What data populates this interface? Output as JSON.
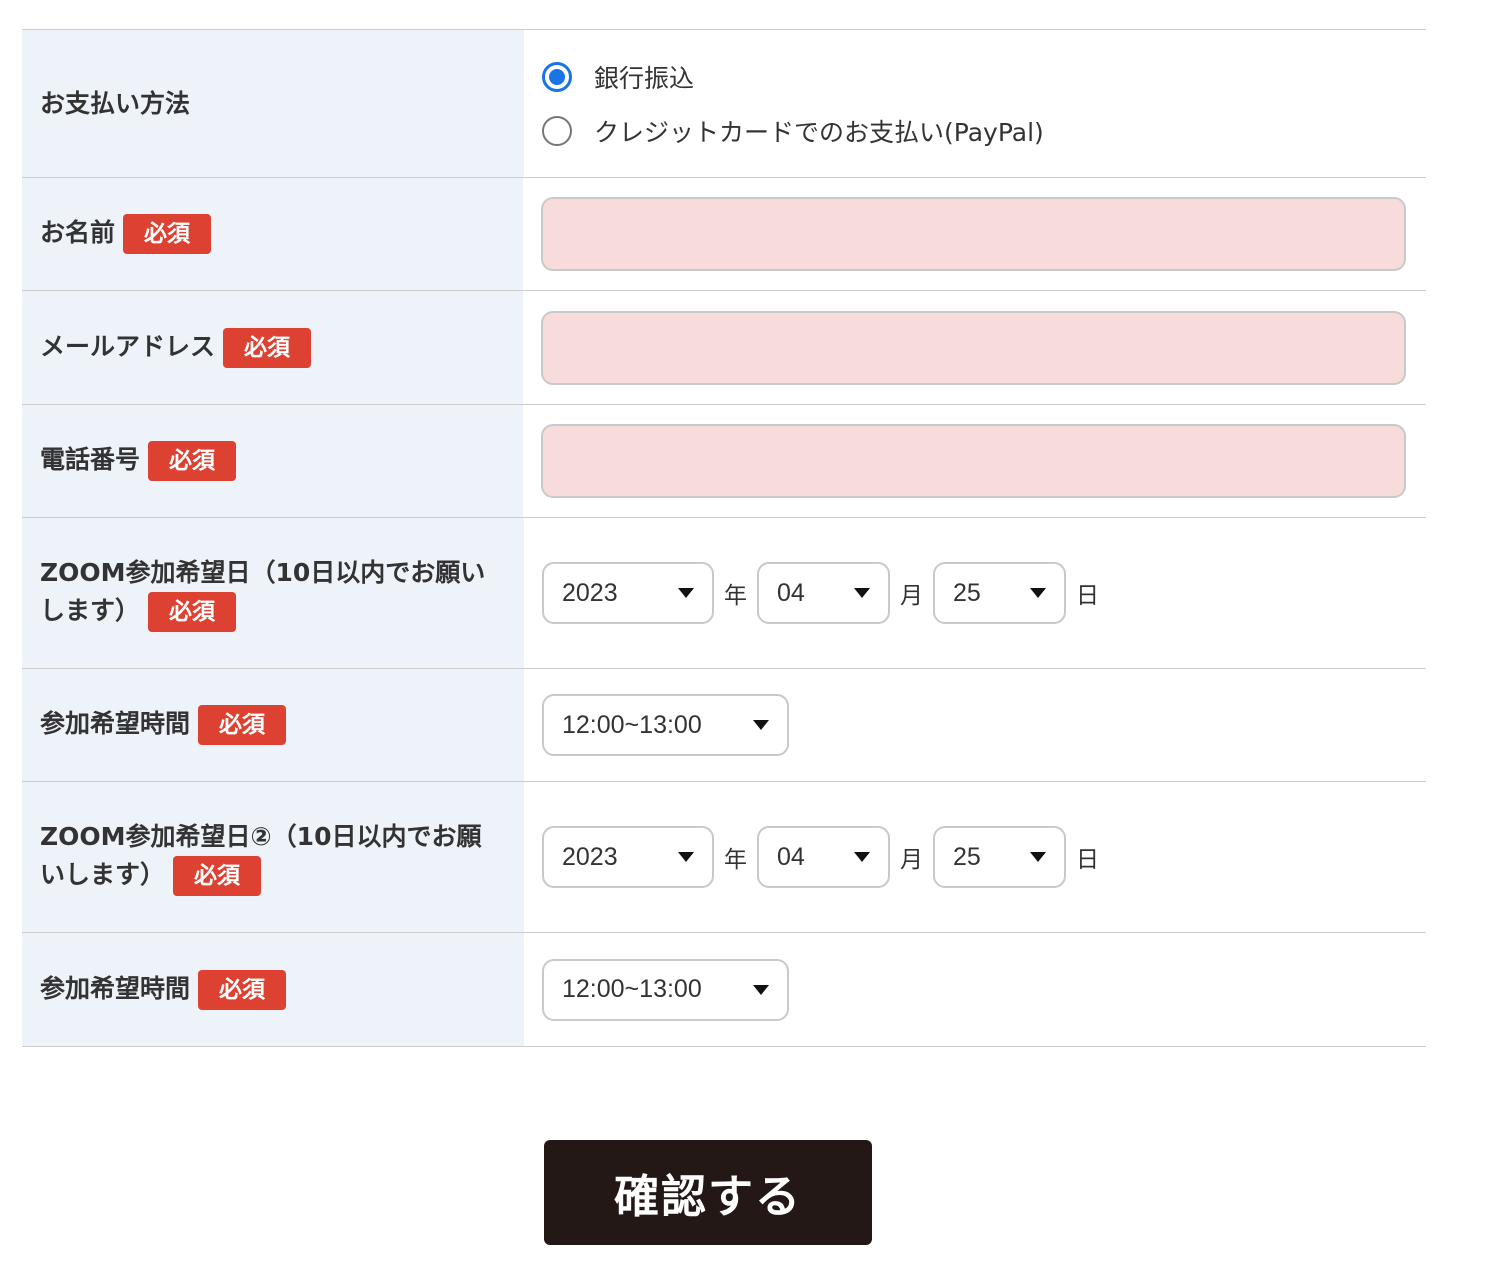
{
  "payment": {
    "label": "お支払い方法",
    "options": [
      {
        "label": "銀行振込",
        "checked": true
      },
      {
        "label": "クレジットカードでのお支払い(PayPal)",
        "checked": false
      }
    ]
  },
  "required_label": "必須",
  "name": {
    "label": "お名前",
    "value": ""
  },
  "email": {
    "label": "メールアドレス",
    "value": ""
  },
  "phone": {
    "label": "電話番号",
    "value": ""
  },
  "date1": {
    "label": "ZOOM参加希望日（10日以内でお願いします）",
    "year": "2023",
    "month": "04",
    "day": "25",
    "year_unit": "年",
    "month_unit": "月",
    "day_unit": "日"
  },
  "time1": {
    "label": "参加希望時間",
    "value": "12:00~13:00"
  },
  "date2": {
    "label": "ZOOM参加希望日②（10日以内でお願いします）",
    "year": "2023",
    "month": "04",
    "day": "25",
    "year_unit": "年",
    "month_unit": "月",
    "day_unit": "日"
  },
  "time2": {
    "label": "参加希望時間",
    "value": "12:00~13:00"
  },
  "submit": {
    "label": "確認する"
  },
  "colors": {
    "required_badge": "#dd4132",
    "label_bg": "#eef3fa",
    "input_bg": "#f8dcdc",
    "radio_accent": "#1a73e8",
    "submit_bg": "#231815"
  }
}
